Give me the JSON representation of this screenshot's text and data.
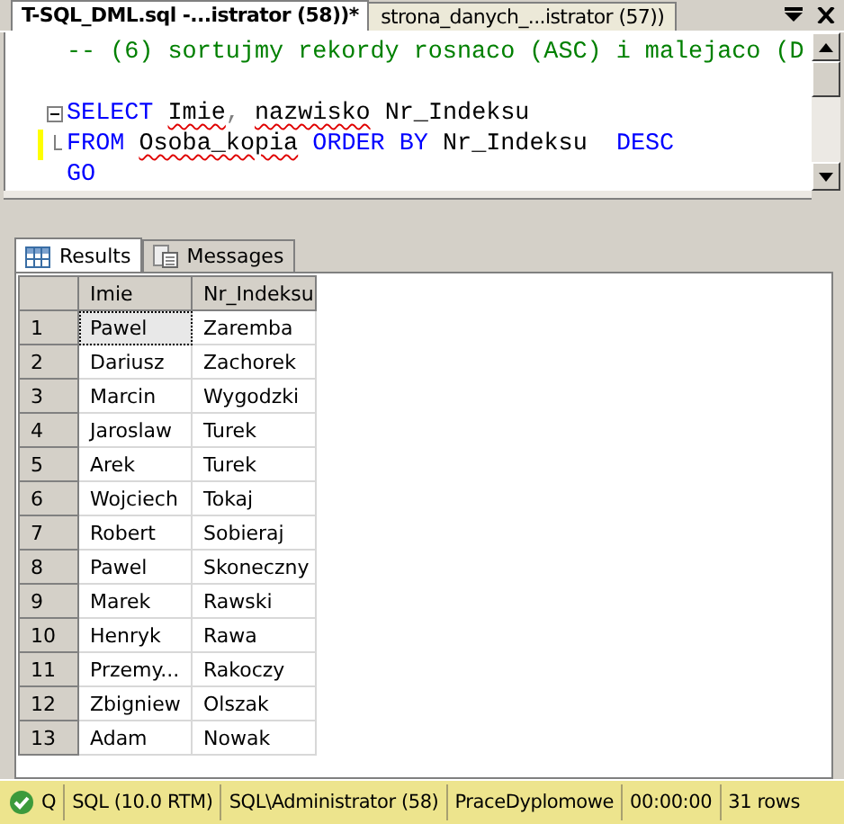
{
  "document_tabs": [
    {
      "label": "T-SQL_DML.sql -...istrator (58))*",
      "selected": true
    },
    {
      "label": "strona_danych_...istrator (57))",
      "selected": false
    }
  ],
  "editor": {
    "lines": [
      {
        "kind": "plain",
        "changed": false,
        "tokens": [
          {
            "text": "-- (6) sortujmy rekordy rosnaco (ASC) i malejaco (D",
            "kind": "comment",
            "squiggle": false
          }
        ]
      },
      {
        "kind": "blank",
        "changed": false
      },
      {
        "kind": "fold-start",
        "changed": false,
        "tokens": [
          {
            "text": "SELECT",
            "kind": "keyword",
            "squiggle": false
          },
          {
            "text": " Imie",
            "kind": "plain",
            "squiggle": true
          },
          {
            "text": ",",
            "kind": "punct",
            "squiggle": false
          },
          {
            "text": " nazwisko",
            "kind": "plain",
            "squiggle": true
          },
          {
            "text": " Nr_Indeksu",
            "kind": "plain",
            "squiggle": false
          }
        ]
      },
      {
        "kind": "fold-end",
        "changed": true,
        "tokens": [
          {
            "text": "FROM",
            "kind": "keyword",
            "squiggle": false
          },
          {
            "text": " Osoba_kopia",
            "kind": "plain",
            "squiggle": true
          },
          {
            "text": " ORDER BY",
            "kind": "keyword",
            "squiggle": false
          },
          {
            "text": " Nr_Indeksu",
            "kind": "plain",
            "squiggle": false
          },
          {
            "text": "  DESC",
            "kind": "keyword",
            "squiggle": false
          }
        ]
      },
      {
        "kind": "plain",
        "changed": false,
        "tokens": [
          {
            "text": "GO",
            "kind": "keyword",
            "squiggle": false
          }
        ]
      }
    ]
  },
  "result_tabs": [
    {
      "label": "Results",
      "kind": "grid",
      "selected": true
    },
    {
      "label": "Messages",
      "kind": "messages",
      "selected": false
    }
  ],
  "table": {
    "columns": [
      "Imie",
      "Nr_Indeksu"
    ],
    "rows": [
      {
        "number": "1",
        "cells": [
          "Pawel",
          "Zaremba"
        ],
        "selected": true
      },
      {
        "number": "2",
        "cells": [
          "Dariusz",
          "Zachorek"
        ],
        "selected": false
      },
      {
        "number": "3",
        "cells": [
          "Marcin",
          "Wygodzki"
        ],
        "selected": false
      },
      {
        "number": "4",
        "cells": [
          "Jaroslaw",
          "Turek"
        ],
        "selected": false
      },
      {
        "number": "5",
        "cells": [
          "Arek",
          "Turek"
        ],
        "selected": false
      },
      {
        "number": "6",
        "cells": [
          "Wojciech",
          "Tokaj"
        ],
        "selected": false
      },
      {
        "number": "7",
        "cells": [
          "Robert",
          "Sobieraj"
        ],
        "selected": false
      },
      {
        "number": "8",
        "cells": [
          "Pawel",
          "Skoneczny"
        ],
        "selected": false
      },
      {
        "number": "9",
        "cells": [
          "Marek",
          "Rawski"
        ],
        "selected": false
      },
      {
        "number": "10",
        "cells": [
          "Henryk",
          "Rawa"
        ],
        "selected": false
      },
      {
        "number": "11",
        "cells": [
          "Przemy...",
          "Rakoczy"
        ],
        "selected": false
      },
      {
        "number": "12",
        "cells": [
          "Zbigniew",
          "Olszak"
        ],
        "selected": false
      },
      {
        "number": "13",
        "cells": [
          "Adam",
          "Nowak"
        ],
        "selected": false
      }
    ]
  },
  "status_bar": {
    "state_letter": "Q",
    "segments": [
      "SQL (10.0 RTM)",
      "SQL\\Administrator (58)",
      "PraceDyplomowe",
      "00:00:00",
      "31 rows"
    ]
  }
}
